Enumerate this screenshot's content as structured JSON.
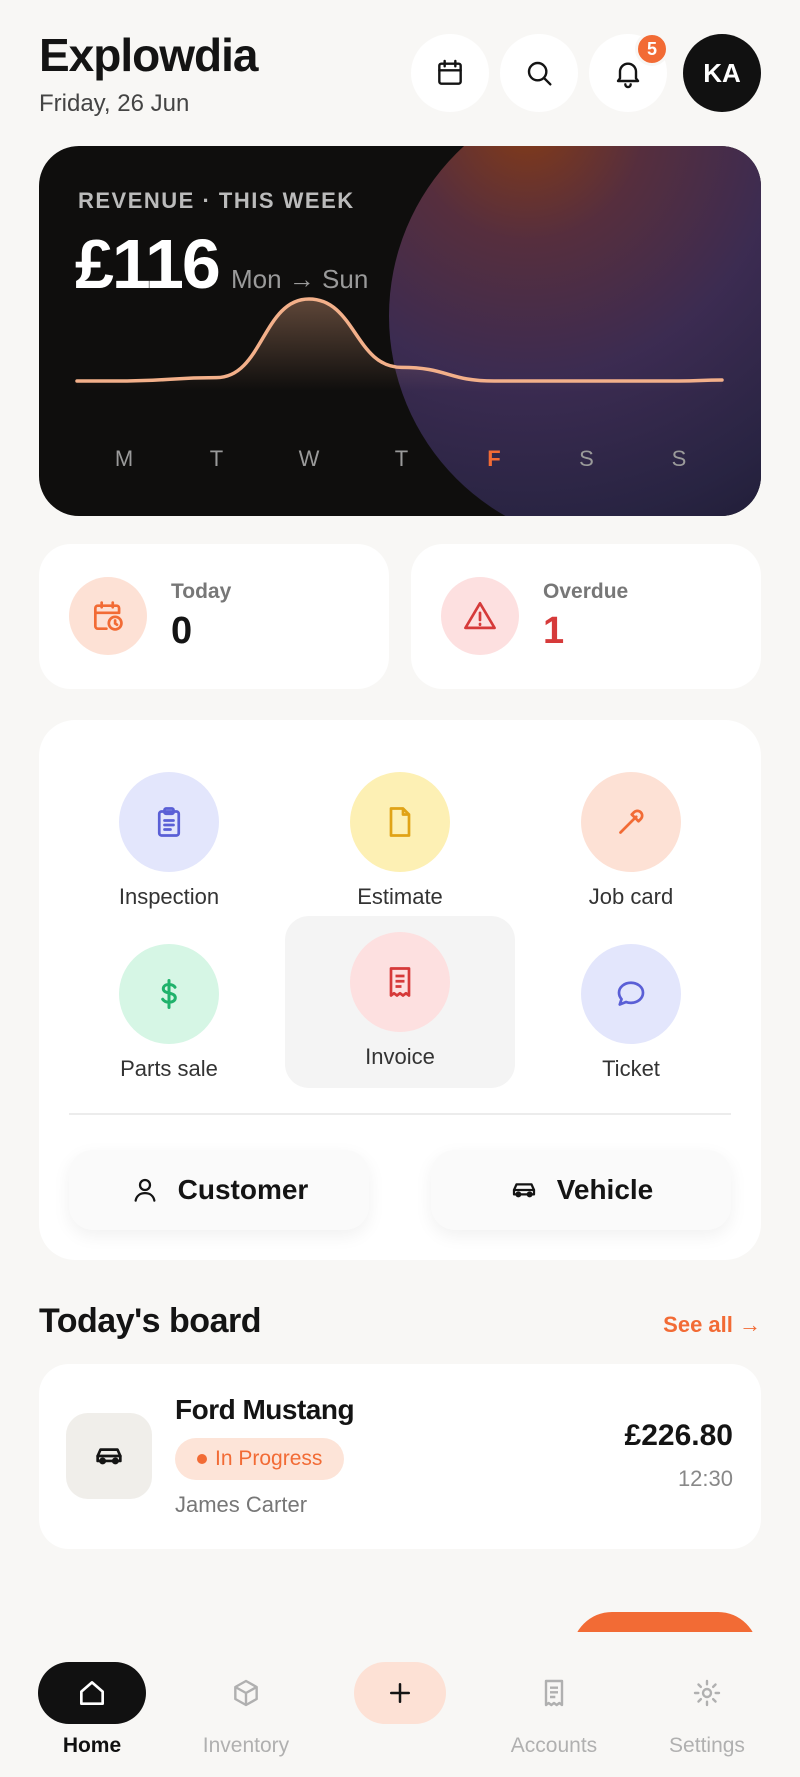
{
  "header": {
    "title": "Explowdia",
    "date": "Friday, 26 Jun",
    "notification_count": "5",
    "avatar_initials": "KA"
  },
  "revenue": {
    "label": "REVENUE · THIS WEEK",
    "amount": "£116",
    "range": "Mon → Sun",
    "days": [
      "M",
      "T",
      "W",
      "T",
      "F",
      "S",
      "S"
    ],
    "active_day_index": 4,
    "values": [
      0,
      2,
      48,
      8,
      0,
      0,
      0
    ]
  },
  "stats": {
    "today_label": "Today",
    "today_value": "0",
    "overdue_label": "Overdue",
    "overdue_value": "1"
  },
  "actions": {
    "inspection": "Inspection",
    "estimate": "Estimate",
    "job_card": "Job card",
    "parts_sale": "Parts sale",
    "invoice": "Invoice",
    "ticket": "Ticket",
    "customer": "Customer",
    "vehicle": "Vehicle"
  },
  "board": {
    "title": "Today's board",
    "see_all": "See all →",
    "jobs": [
      {
        "vehicle": "Ford Mustang",
        "status": "In Progress",
        "customer": "James Carter",
        "amount": "£226.80",
        "time": "12:30"
      }
    ]
  },
  "nav": {
    "home": "Home",
    "inventory": "Inventory",
    "accounts": "Accounts",
    "settings": "Settings"
  },
  "colors": {
    "accent": "#f26b35",
    "danger": "#d63a3a",
    "dark": "#111111"
  }
}
